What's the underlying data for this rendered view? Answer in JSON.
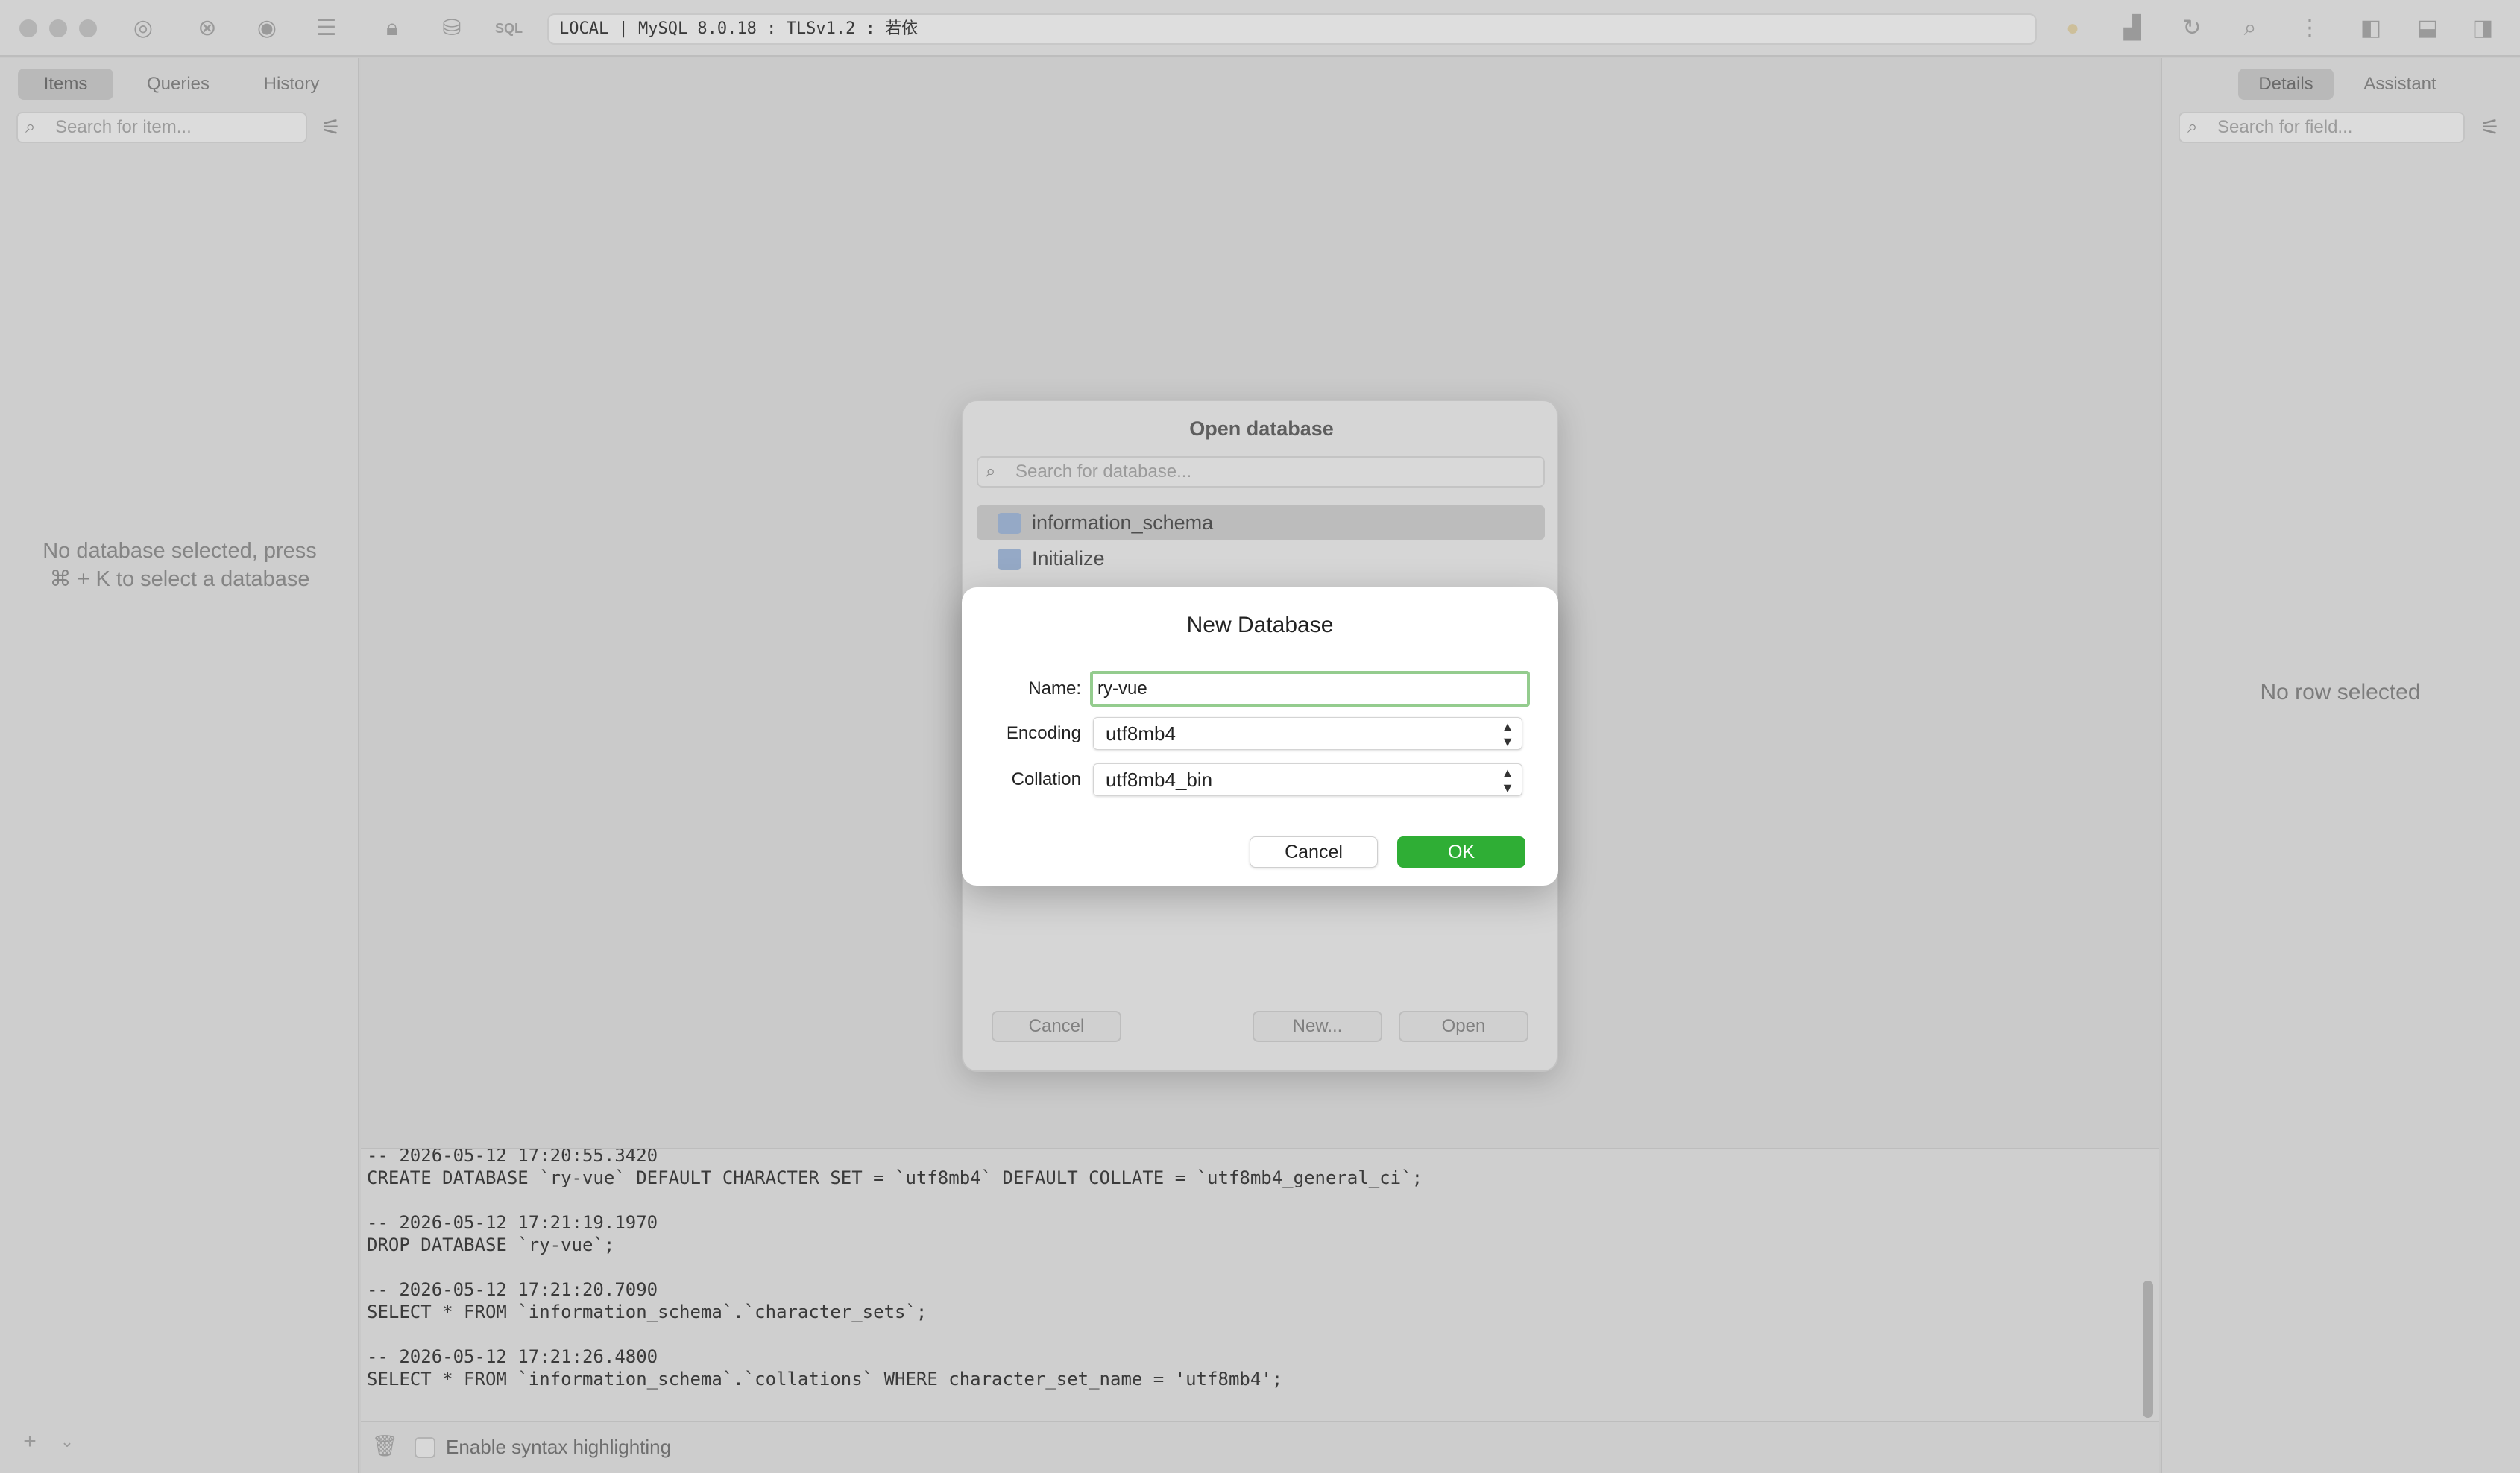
{
  "toolbar": {
    "connection_text": "LOCAL | MySQL 8.0.18 : TLSv1.2 : 若依",
    "sql_label": "SQL"
  },
  "sidebar": {
    "tabs": [
      {
        "label": "Items",
        "active": true
      },
      {
        "label": "Queries",
        "active": false
      },
      {
        "label": "History",
        "active": false
      }
    ],
    "search_placeholder": "Search for item...",
    "empty_message_line1": "No database selected, press",
    "empty_message_line2": "⌘ + K to select a database"
  },
  "right_panel": {
    "tabs": [
      {
        "label": "Details",
        "active": true
      },
      {
        "label": "Assistant",
        "active": false
      }
    ],
    "search_placeholder": "Search for field...",
    "empty_message": "No row selected"
  },
  "open_database": {
    "title": "Open database",
    "search_placeholder": "Search for database...",
    "databases": [
      "information_schema",
      "Initialize"
    ],
    "cancel_label": "Cancel",
    "new_label": "New...",
    "open_label": "Open"
  },
  "new_database": {
    "title": "New Database",
    "name_label": "Name:",
    "name_value": "ry-vue",
    "encoding_label": "Encoding",
    "encoding_value": "utf8mb4",
    "collation_label": "Collation",
    "collation_value": "utf8mb4_bin",
    "cancel_label": "Cancel",
    "ok_label": "OK"
  },
  "log": {
    "lines": [
      "-- 2026-05-12 17:20:55.3420",
      "CREATE DATABASE `ry-vue` DEFAULT CHARACTER SET = `utf8mb4` DEFAULT COLLATE = `utf8mb4_general_ci`;",
      "",
      "-- 2026-05-12 17:21:19.1970",
      "DROP DATABASE `ry-vue`;",
      "",
      "-- 2026-05-12 17:21:20.7090",
      "SELECT * FROM `information_schema`.`character_sets`;",
      "",
      "-- 2026-05-12 17:21:26.4800",
      "SELECT * FROM `information_schema`.`collations` WHERE character_set_name = 'utf8mb4';"
    ],
    "syntax_highlight_label": "Enable syntax highlighting"
  },
  "colors": {
    "ok_button": "#2fae35",
    "name_focus_ring": "#94cc8e",
    "db_icon": "#95a9c6"
  }
}
